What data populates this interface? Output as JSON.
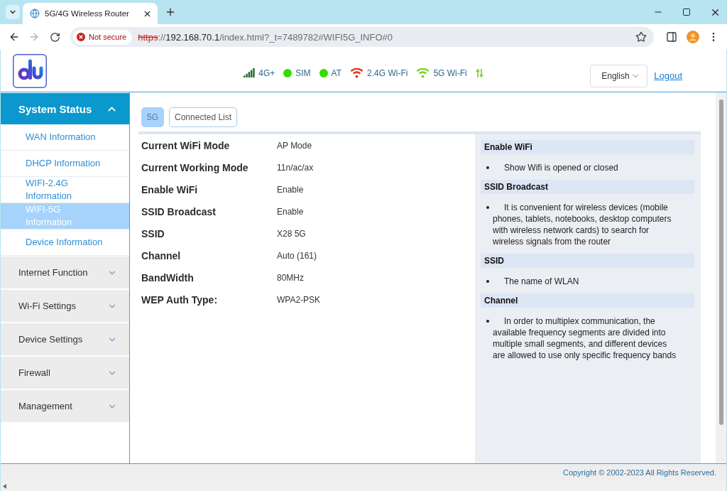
{
  "browser": {
    "tabs": [
      {
        "title": "5G/4G Wireless Router",
        "selected": true
      }
    ],
    "forward_disabled": true,
    "security": "Not secure",
    "url": {
      "secure": false,
      "scheme": "https",
      "separator": "://",
      "host": "192.168.70.1",
      "path": "/index.html?_t=7489782#WIFI5G_INFO#0"
    }
  },
  "header": {
    "status": [
      {
        "kind": "signal",
        "label": "4G+",
        "color": "#2e6b3a"
      },
      {
        "kind": "dot",
        "label": "SIM",
        "color": "#33dd00"
      },
      {
        "kind": "dot",
        "label": "AT",
        "color": "#33dd00"
      },
      {
        "kind": "wifi",
        "label": "2.4G Wi-Fi",
        "color": "#e8321e"
      },
      {
        "kind": "wifi",
        "label": "5G Wi-Fi",
        "color": "#7dd321"
      },
      {
        "kind": "transfer",
        "color": "#86d43c"
      }
    ],
    "language": "English",
    "logout": "Logout"
  },
  "sidebar": {
    "sections": [
      {
        "label": "System Status",
        "expanded": true,
        "children": [
          {
            "label": "WAN Information",
            "selected": false
          },
          {
            "label": "DHCP Information",
            "selected": false
          },
          {
            "label": "WIFI-2.4G Information",
            "selected": false
          },
          {
            "label": "WIFI-5G Information",
            "selected": true
          },
          {
            "label": "Device Information",
            "selected": false
          }
        ]
      },
      {
        "label": "Internet Function",
        "expanded": false
      },
      {
        "label": "Wi-Fi Settings",
        "expanded": false
      },
      {
        "label": "Device Settings",
        "expanded": false
      },
      {
        "label": "Firewall",
        "expanded": false
      },
      {
        "label": "Management",
        "expanded": false
      }
    ]
  },
  "content": {
    "tabs": [
      {
        "label": "5G",
        "selected": true
      },
      {
        "label": "Connected List",
        "selected": false
      }
    ],
    "info_rows": [
      {
        "label": "Current WiFi Mode",
        "value": "AP Mode"
      },
      {
        "label": "Current Working Mode",
        "value": "11n/ac/ax"
      },
      {
        "label": "Enable WiFi",
        "value": "Enable"
      },
      {
        "label": "SSID Broadcast",
        "value": "Enable"
      },
      {
        "label": "SSID",
        "value": "X28 5G"
      },
      {
        "label": "Channel",
        "value": "Auto (161)"
      },
      {
        "label": "BandWidth",
        "value": "80MHz"
      },
      {
        "label": "WEP Auth Type:",
        "value": "WPA2-PSK"
      }
    ],
    "help": [
      {
        "title": "Enable WiFi",
        "points": [
          "Show Wifi is opened or closed"
        ]
      },
      {
        "title": "SSID Broadcast",
        "points": [
          "It is convenient for wireless devices (mobile phones, tablets, notebooks, desktop computers with wireless network cards) to search for wireless signals from the router"
        ]
      },
      {
        "title": "SSID",
        "points": [
          "The name of WLAN"
        ]
      },
      {
        "title": "Channel",
        "points": [
          "In order to multiplex communication, the available frequency segments are divided into multiple small segments, and different devices are allowed to use only specific frequency bands"
        ]
      }
    ]
  },
  "footer": {
    "copyright": "Copyright © 2002-2023 All Rights Reserved."
  }
}
